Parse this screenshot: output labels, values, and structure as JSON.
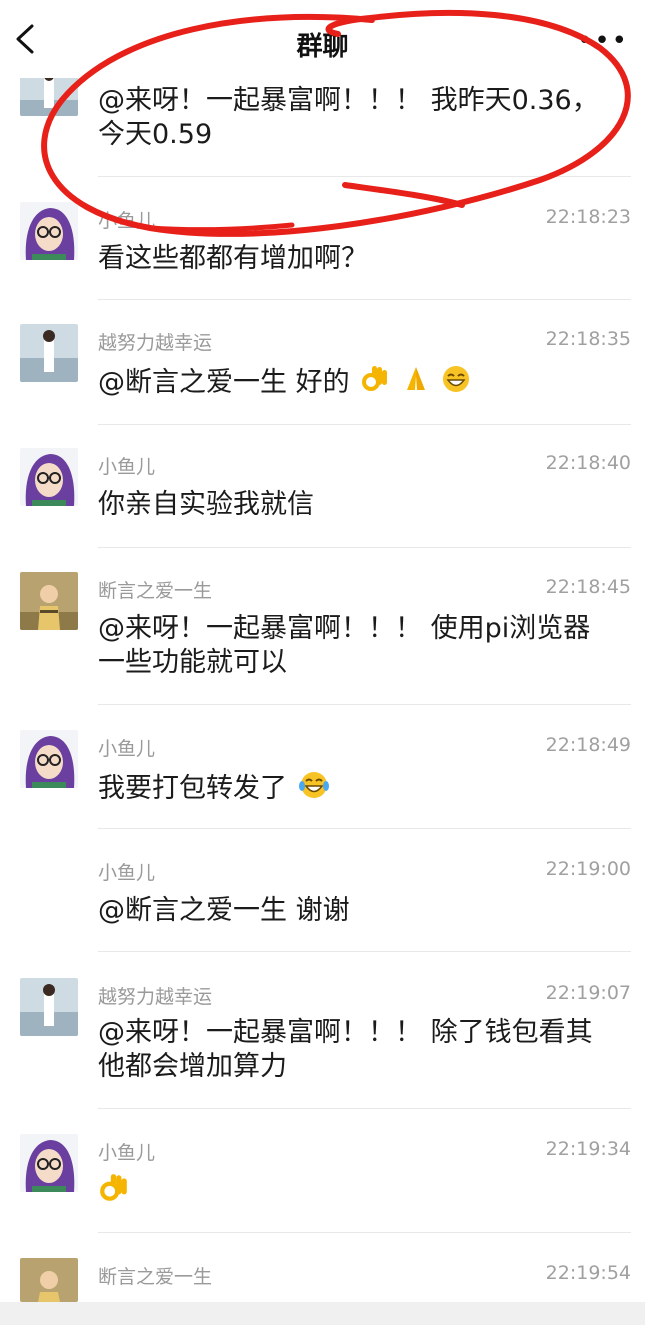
{
  "header": {
    "title": "群聊",
    "more": "•••"
  },
  "messages": [
    {
      "sender": "",
      "time": "",
      "avatar": "beach-man",
      "lines": [
        "@来呀！一起暴富啊！！！ 我昨天0.36，",
        "今天0.59"
      ]
    },
    {
      "sender": "小鱼儿",
      "time": "22:18:23",
      "avatar": "girl-glasses",
      "lines": [
        "看这些都都有增加啊？"
      ]
    },
    {
      "sender": "越努力越幸运",
      "time": "22:18:35",
      "avatar": "beach-man",
      "lines": [
        "@断言之爱一生 好的"
      ],
      "emojis": [
        "ok-hand",
        "pray-hands",
        "grin"
      ]
    },
    {
      "sender": "小鱼儿",
      "time": "22:18:40",
      "avatar": "girl-glasses",
      "lines": [
        "你亲自实验我就信"
      ]
    },
    {
      "sender": "断言之爱一生",
      "time": "22:18:45",
      "avatar": "boy-field",
      "lines": [
        "@来呀！一起暴富啊！！！ 使用pi浏览器",
        "一些功能就可以"
      ]
    },
    {
      "sender": "小鱼儿",
      "time": "22:18:49",
      "avatar": "girl-glasses",
      "lines": [
        "我要打包转发了"
      ],
      "emojis": [
        "laugh-tears"
      ]
    },
    {
      "sender": "小鱼儿",
      "time": "22:19:00",
      "avatar": "",
      "lines": [
        "@断言之爱一生 谢谢"
      ]
    },
    {
      "sender": "越努力越幸运",
      "time": "22:19:07",
      "avatar": "beach-man",
      "lines": [
        "@来呀！一起暴富啊！！！ 除了钱包看其",
        "他都会增加算力"
      ]
    },
    {
      "sender": "小鱼儿",
      "time": "22:19:34",
      "avatar": "girl-glasses",
      "lines": [
        ""
      ],
      "emojis": [
        "ok-hand"
      ]
    },
    {
      "sender": "断言之爱一生",
      "time": "22:19:54",
      "avatar": "boy-field",
      "lines": []
    }
  ],
  "annotation": {
    "color": "#e8201a",
    "shape": "hand-drawn-ellipse"
  }
}
